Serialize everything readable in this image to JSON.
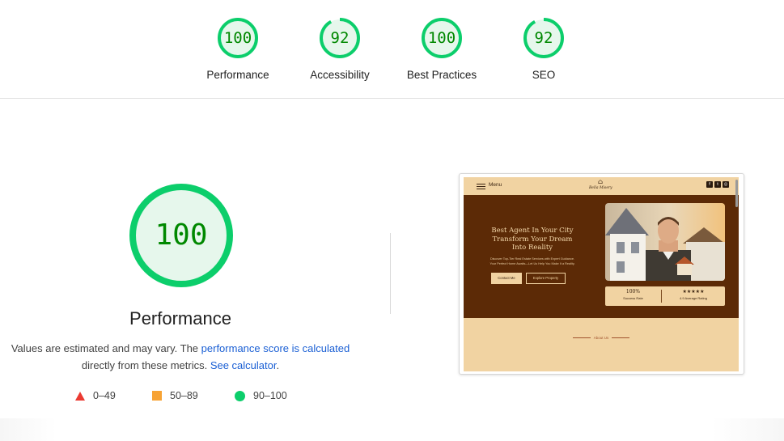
{
  "summary_scores": [
    {
      "label": "Performance",
      "score": "100",
      "value": 1.0
    },
    {
      "label": "Accessibility",
      "score": "92",
      "value": 0.92
    },
    {
      "label": "Best Practices",
      "score": "100",
      "value": 1.0
    },
    {
      "label": "SEO",
      "score": "92",
      "value": 0.92
    }
  ],
  "performance": {
    "score": "100",
    "title": "Performance",
    "desc_prefix": "Values are estimated and may vary. The ",
    "desc_link": "performance score is calculated",
    "desc_middle": " directly from these metrics. ",
    "desc_calc_link": "See calculator",
    "desc_suffix": "."
  },
  "legend": [
    {
      "icon": "triangle-icon",
      "range": "0–49",
      "color": "#eb3a32"
    },
    {
      "icon": "square-icon",
      "range": "50–89",
      "color": "#f7a334"
    },
    {
      "icon": "circle-icon",
      "range": "90–100",
      "color": "#0cce6b"
    }
  ],
  "colors": {
    "pass_green": "#0cce6b",
    "pass_text": "#008800",
    "pass_fill": "#e6f7ec",
    "link_blue": "#1a5fd4"
  },
  "screenshot": {
    "menu_label": "Menu",
    "logo_text": "Bella Misery",
    "social_icons": [
      "facebook-icon",
      "twitter-icon",
      "instagram-icon"
    ],
    "hero_title_1": "Best Agent In Your City",
    "hero_title_2": "Transform Your Dream",
    "hero_title_3": "Into Reality",
    "hero_sub_1": "Discover Top-Tier Real Estate Services with Expert Guidance.",
    "hero_sub_2": "Your Perfect Home Awaits—Let Us Help You Make It a Reality.",
    "contact_btn": "Contact Me",
    "explore_btn": "Explore Property",
    "stat_1_value": "100%",
    "stat_1_label": "Success Rate",
    "stat_2_value": "★★★★★",
    "stat_2_label": "4.9 Average Rating",
    "about_label": "About Us",
    "colors": {
      "hero_bg": "#5c2a06",
      "page_bg": "#f1d3a2"
    }
  }
}
